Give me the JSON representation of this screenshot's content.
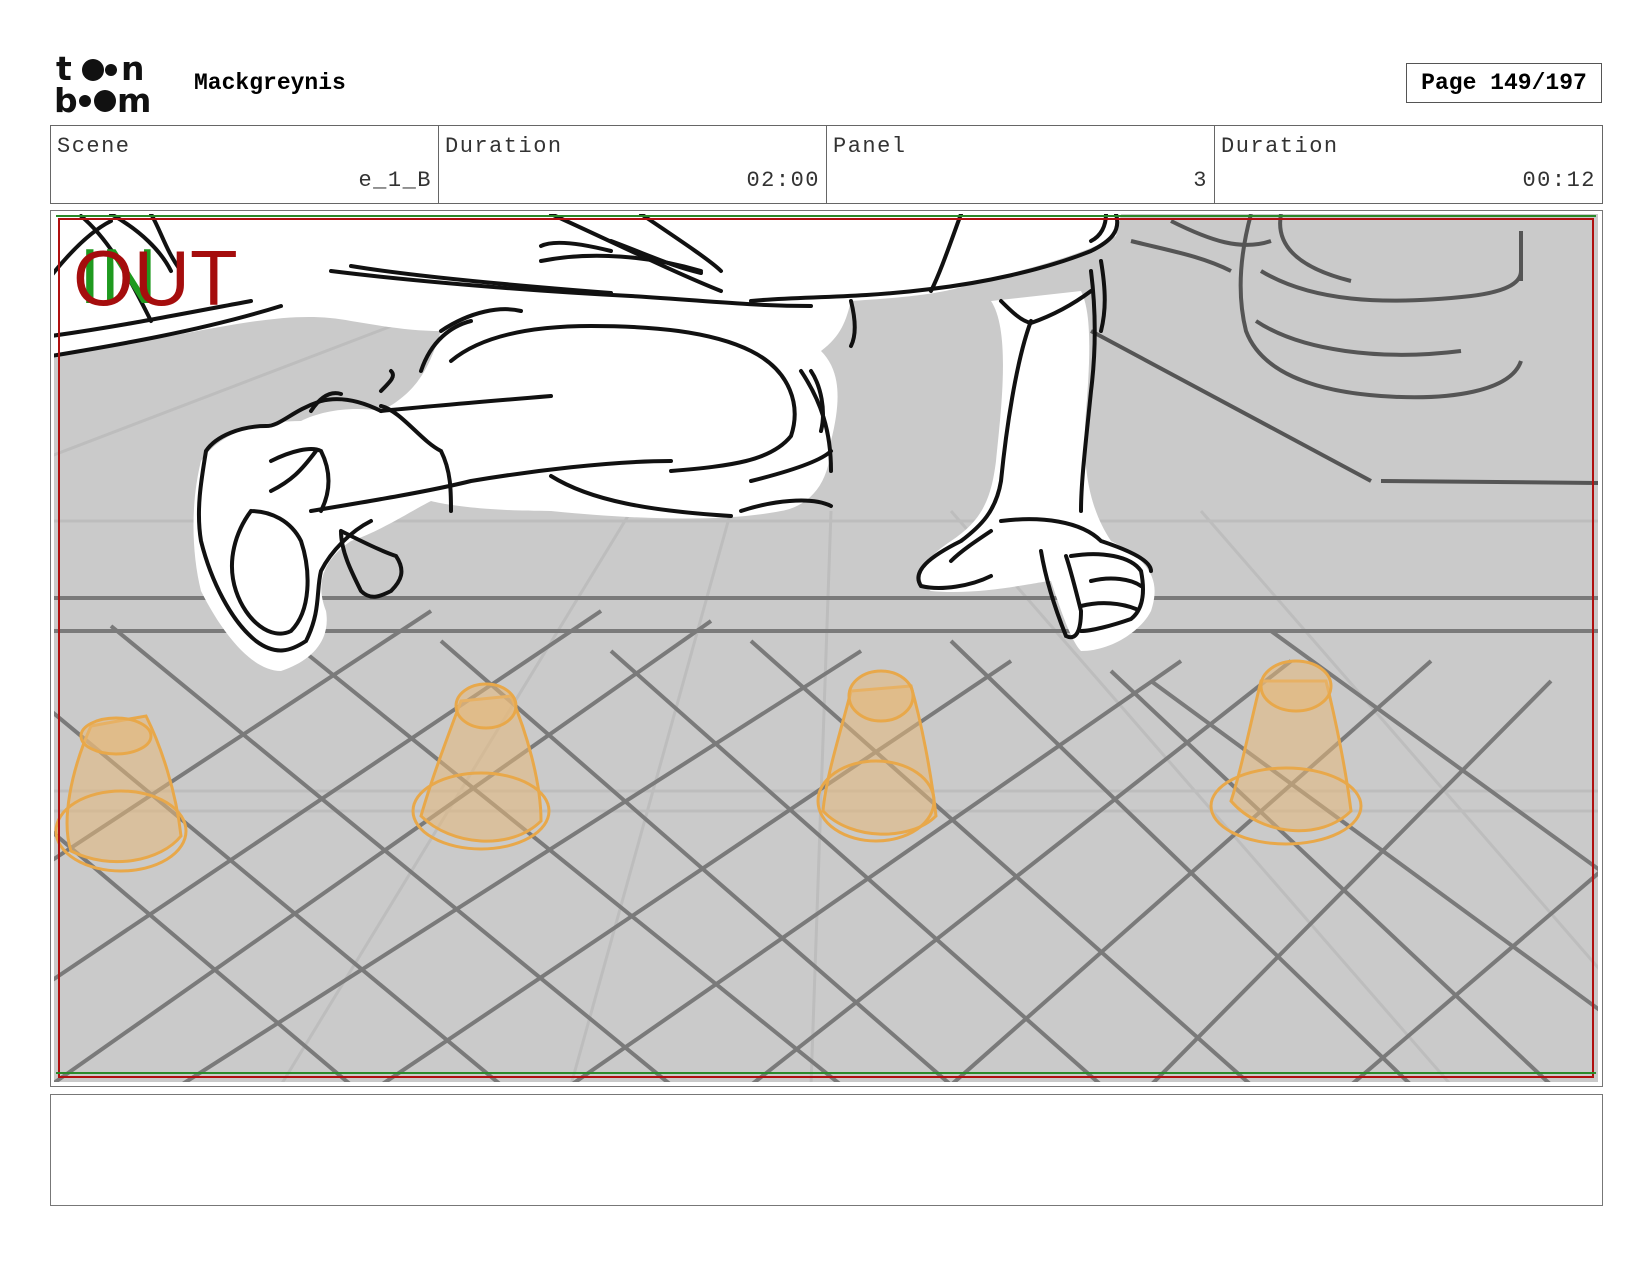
{
  "header": {
    "logo_alt": "toon boom",
    "project_title": "Mackgreynis",
    "page_indicator": "Page 149/197"
  },
  "info": {
    "scene_label": "Scene",
    "scene_value": "e_1_B",
    "scene_duration_label": "Duration",
    "scene_duration_value": "02:00",
    "panel_label": "Panel",
    "panel_value": "3",
    "panel_duration_label": "Duration",
    "panel_duration_value": "00:12"
  },
  "panel": {
    "transition_in_label": "IN",
    "transition_out_label": "OUT",
    "colors": {
      "background": "#cacaca",
      "safe_frame_red": "#b01010",
      "safe_frame_green": "#2a8a2a",
      "floor_lines": "#7a7a7a",
      "cones": "#e8a84a",
      "ink": "#111111"
    }
  },
  "notes": {
    "text": ""
  }
}
